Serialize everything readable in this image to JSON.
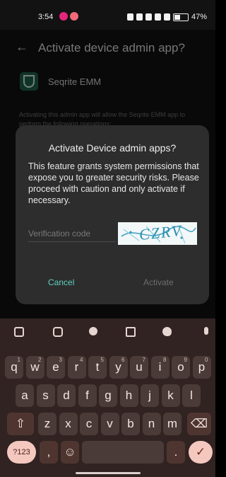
{
  "status_bar": {
    "time": "3:54",
    "battery": "47%",
    "notification_colors": [
      "#e4267a",
      "#f06a7a"
    ]
  },
  "background_screen": {
    "title": "Activate device admin app?",
    "app_name": "Seqrite EMM",
    "description": "Activating this admin app will allow the Seqrite EMM app to perform the following operations:"
  },
  "dialog": {
    "title": "Activate Device admin apps?",
    "body": "This feature grants system permissions that expose you to greater security risks. Please proceed with caution and only activate if necessary.",
    "code_placeholder": "Verification code",
    "captcha_text": "CZRV",
    "cancel_label": "Cancel",
    "activate_label": "Activate",
    "accent_color": "#5fd0c0"
  },
  "keyboard": {
    "toolbar_icons": [
      "grid-icon",
      "sticker-icon",
      "settings-icon",
      "translate-icon",
      "palette-icon",
      "mic-icon"
    ],
    "row1": [
      {
        "k": "q",
        "s": "1"
      },
      {
        "k": "w",
        "s": "2"
      },
      {
        "k": "e",
        "s": "3"
      },
      {
        "k": "r",
        "s": "4"
      },
      {
        "k": "t",
        "s": "5"
      },
      {
        "k": "y",
        "s": "6"
      },
      {
        "k": "u",
        "s": "7"
      },
      {
        "k": "i",
        "s": "8"
      },
      {
        "k": "o",
        "s": "9"
      },
      {
        "k": "p",
        "s": "0"
      }
    ],
    "row2": [
      "a",
      "s",
      "d",
      "f",
      "g",
      "h",
      "j",
      "k",
      "l"
    ],
    "row3": [
      "z",
      "x",
      "c",
      "v",
      "b",
      "n",
      "m"
    ],
    "symbols_label": "?123",
    "comma_label": ",",
    "emoji_label": "☺",
    "period_label": ".",
    "shift_label": "⇧",
    "backspace_label": "⌫",
    "enter_label": "✓"
  }
}
